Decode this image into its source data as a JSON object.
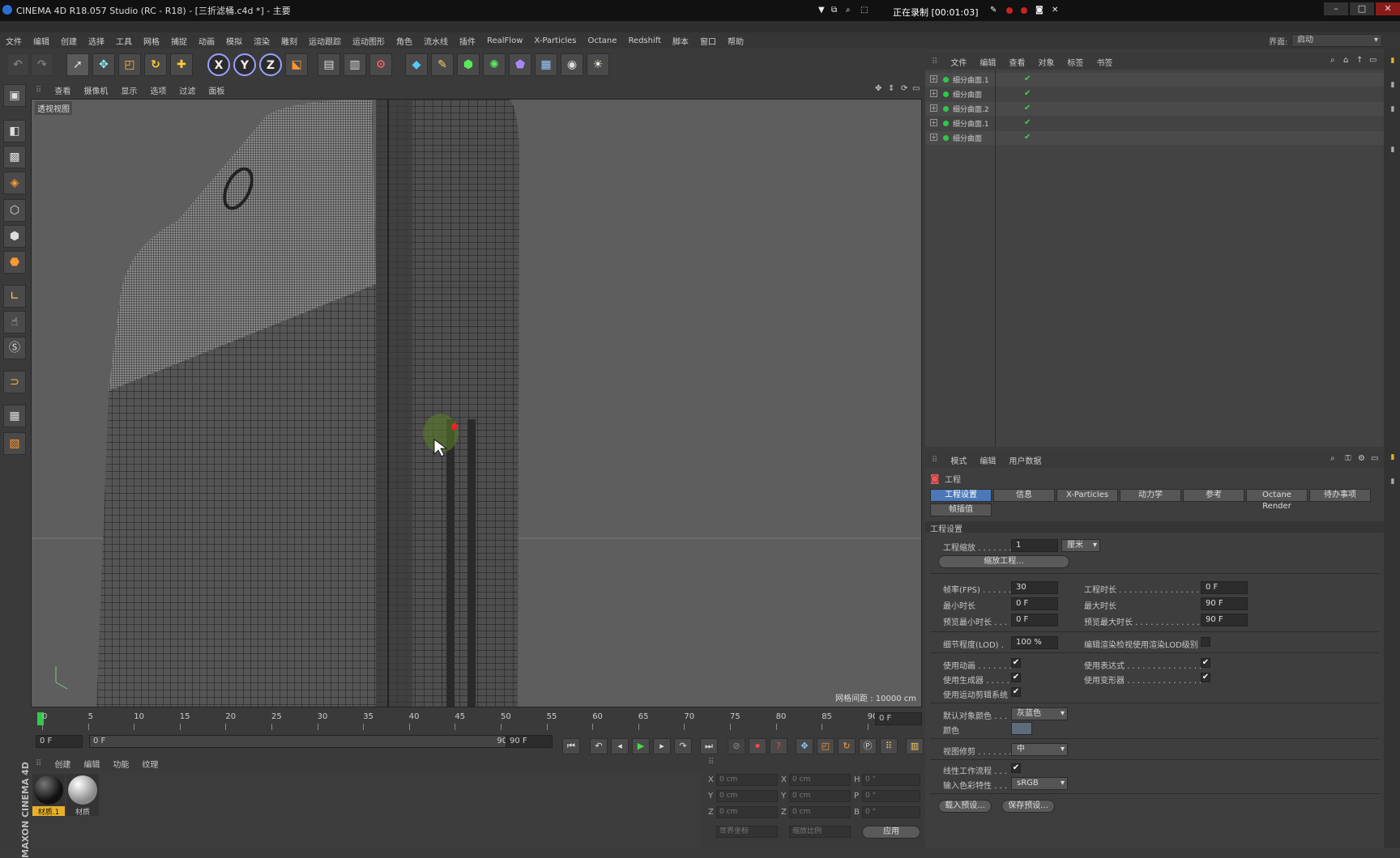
{
  "window": {
    "title": "CINEMA 4D R18.057 Studio (RC - R18) - [三折滤桶.c4d *] - 主要",
    "recording": "正在录制 [00:01:03]",
    "minimize": "–",
    "maximize": "□",
    "close": "✕"
  },
  "menubar": [
    "文件",
    "编辑",
    "创建",
    "选择",
    "工具",
    "网格",
    "捕捉",
    "动画",
    "模拟",
    "渲染",
    "雕刻",
    "运动跟踪",
    "运动图形",
    "角色",
    "流水线",
    "插件",
    "RealFlow",
    "X-Particles",
    "Octane",
    "Redshift",
    "脚本",
    "窗口",
    "帮助"
  ],
  "layout": {
    "label": "界面:",
    "value": "启动"
  },
  "toolbar": {
    "axis": [
      "X",
      "Y",
      "Z"
    ]
  },
  "viewport": {
    "menu": [
      "查看",
      "摄像机",
      "显示",
      "选项",
      "过滤",
      "面板"
    ],
    "label": "透视视图",
    "grid_info": "网格间距 : 10000 cm"
  },
  "timeline": {
    "ticks": [
      "0",
      "5",
      "10",
      "15",
      "20",
      "25",
      "30",
      "35",
      "40",
      "45",
      "50",
      "55",
      "60",
      "65",
      "70",
      "75",
      "80",
      "85",
      "90"
    ],
    "current_frame": "0 F",
    "start": "0 F",
    "range_start": "0 F",
    "range_end": "90 F",
    "end": "90 F"
  },
  "material_manager": {
    "menu": [
      "创建",
      "编辑",
      "功能",
      "纹理"
    ],
    "materials": [
      {
        "name": "材质.1",
        "color": "#1a1a1a"
      },
      {
        "name": "材质",
        "color": "#bfbfbf"
      }
    ]
  },
  "coordinates": {
    "rows": [
      {
        "axis1": "X",
        "v1": "0 cm",
        "axis2": "X",
        "v2": "0 cm",
        "axis3": "H",
        "v3": "0 °"
      },
      {
        "axis1": "Y",
        "v1": "0 cm",
        "axis2": "Y",
        "v2": "0 cm",
        "axis3": "P",
        "v3": "0 °"
      },
      {
        "axis1": "Z",
        "v1": "0 cm",
        "axis2": "Z",
        "v2": "0 cm",
        "axis3": "B",
        "v3": "0 °"
      }
    ],
    "mode1": "世界坐标",
    "mode2": "缩放比例",
    "apply": "应用"
  },
  "object_manager": {
    "menu": [
      "文件",
      "编辑",
      "查看",
      "对象",
      "标签",
      "书签"
    ],
    "objects": [
      "细分曲面.1",
      "细分曲面",
      "细分曲面.2",
      "细分曲面.1",
      "细分曲面"
    ]
  },
  "attribute_manager": {
    "menu": [
      "模式",
      "编辑",
      "用户数据"
    ],
    "header": "工程",
    "tabs": [
      "工程设置",
      "信息",
      "X-Particles",
      "动力学",
      "参考",
      "Octane Render",
      "待办事项",
      "帧插值"
    ],
    "section": "工程设置",
    "scale_label": "工程缩放 . . . . . . .",
    "scale_value": "1",
    "scale_unit": "厘米",
    "scale_button": "缩放工程...",
    "fps_label": "帧率(FPS) . . . . . . .",
    "fps": "30",
    "min_time_label": "最小时长",
    "min_time": "0 F",
    "preview_min_label": "预览最小时长 . . .",
    "preview_min": "0 F",
    "project_time_label": "工程时长 . . . . . . . . . . . . . . . . . . . .",
    "project_time": "0 F",
    "max_time_label": "最大时长",
    "max_time": "90 F",
    "preview_max_label": "预览最大时长 . . . . . . . . . . . . . . . . .",
    "preview_max": "90 F",
    "lod_label": "细节程度(LOD) .",
    "lod": "100 %",
    "lod_render_label": "编辑渲染检视使用渲染LOD级别",
    "use_anim_label": "使用动画 . . . . . . .",
    "use_gen_label": "使用生成器 . . . . .",
    "use_motion_label": "使用运动剪辑系统",
    "use_expr_label": "使用表达式 . . . . . . . . . . . . . . .",
    "use_deform_label": "使用变形器 . . . . . . . . . . . . . . .",
    "default_color_label": "默认对象颜色 . . .",
    "default_color": "灰蓝色",
    "color_label": "颜色",
    "view_clip_label": "视图修剪 . . . . . . .",
    "view_clip": "中",
    "linear_label": "线性工作流程 . . .",
    "input_color_label": "输入色彩特性 . . .",
    "input_color": "sRGB",
    "load_preset": "载入预设...",
    "save_preset": "保存预设..."
  },
  "colors": {
    "accent": "#4a78b8",
    "active_green": "#31c94a",
    "viewport_bg": "#5e5e5e"
  }
}
